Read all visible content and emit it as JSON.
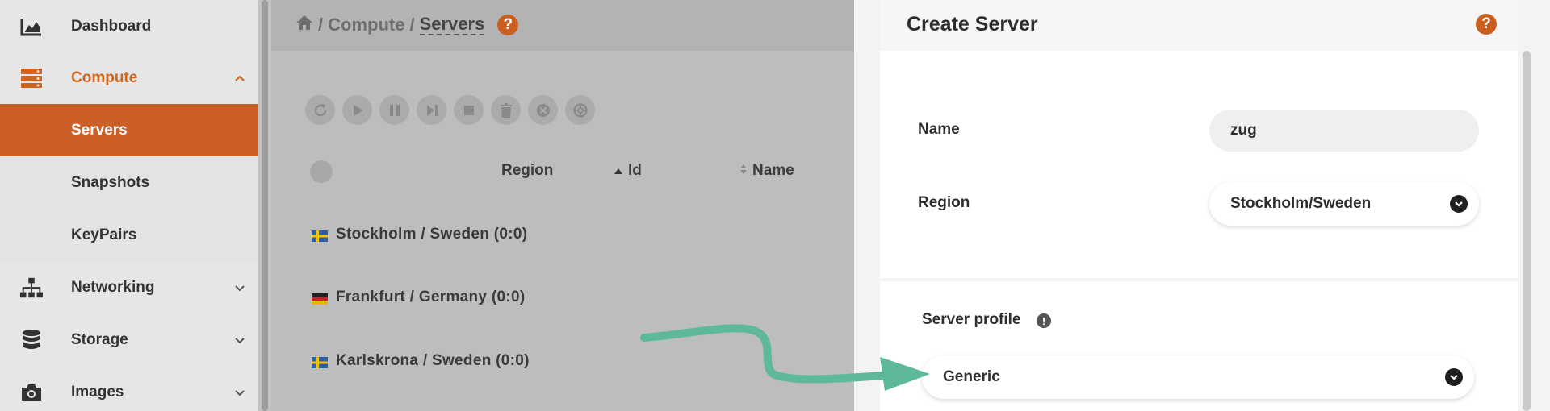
{
  "sidebar": {
    "items": [
      {
        "label": "Dashboard",
        "icon": "chart-icon"
      },
      {
        "label": "Compute",
        "icon": "server-stack-icon"
      },
      {
        "label": "Servers"
      },
      {
        "label": "Snapshots"
      },
      {
        "label": "KeyPairs"
      },
      {
        "label": "Networking",
        "icon": "network-icon"
      },
      {
        "label": "Storage",
        "icon": "database-icon"
      },
      {
        "label": "Images",
        "icon": "camera-icon"
      }
    ]
  },
  "breadcrumb": {
    "sep1": "/",
    "section": "Compute",
    "sep2": "/",
    "current": "Servers",
    "help": "?"
  },
  "table": {
    "columns": {
      "region": "Region",
      "id": "Id",
      "name": "Name"
    },
    "rows": [
      {
        "region": "Stockholm / Sweden (0:0)",
        "flag": "sweden"
      },
      {
        "region": "Frankfurt / Germany (0:0)",
        "flag": "germany"
      },
      {
        "region": "Karlskrona / Sweden (0:0)",
        "flag": "sweden"
      }
    ]
  },
  "panel": {
    "title": "Create Server",
    "help": "?",
    "name_label": "Name",
    "name_value": "zug",
    "region_label": "Region",
    "region_value": "Stockholm/Sweden",
    "profile_label": "Server profile",
    "profile_info": "!",
    "profile_value": "Generic"
  },
  "colors": {
    "accent": "#cc5f27",
    "arrow": "#5db89c"
  }
}
